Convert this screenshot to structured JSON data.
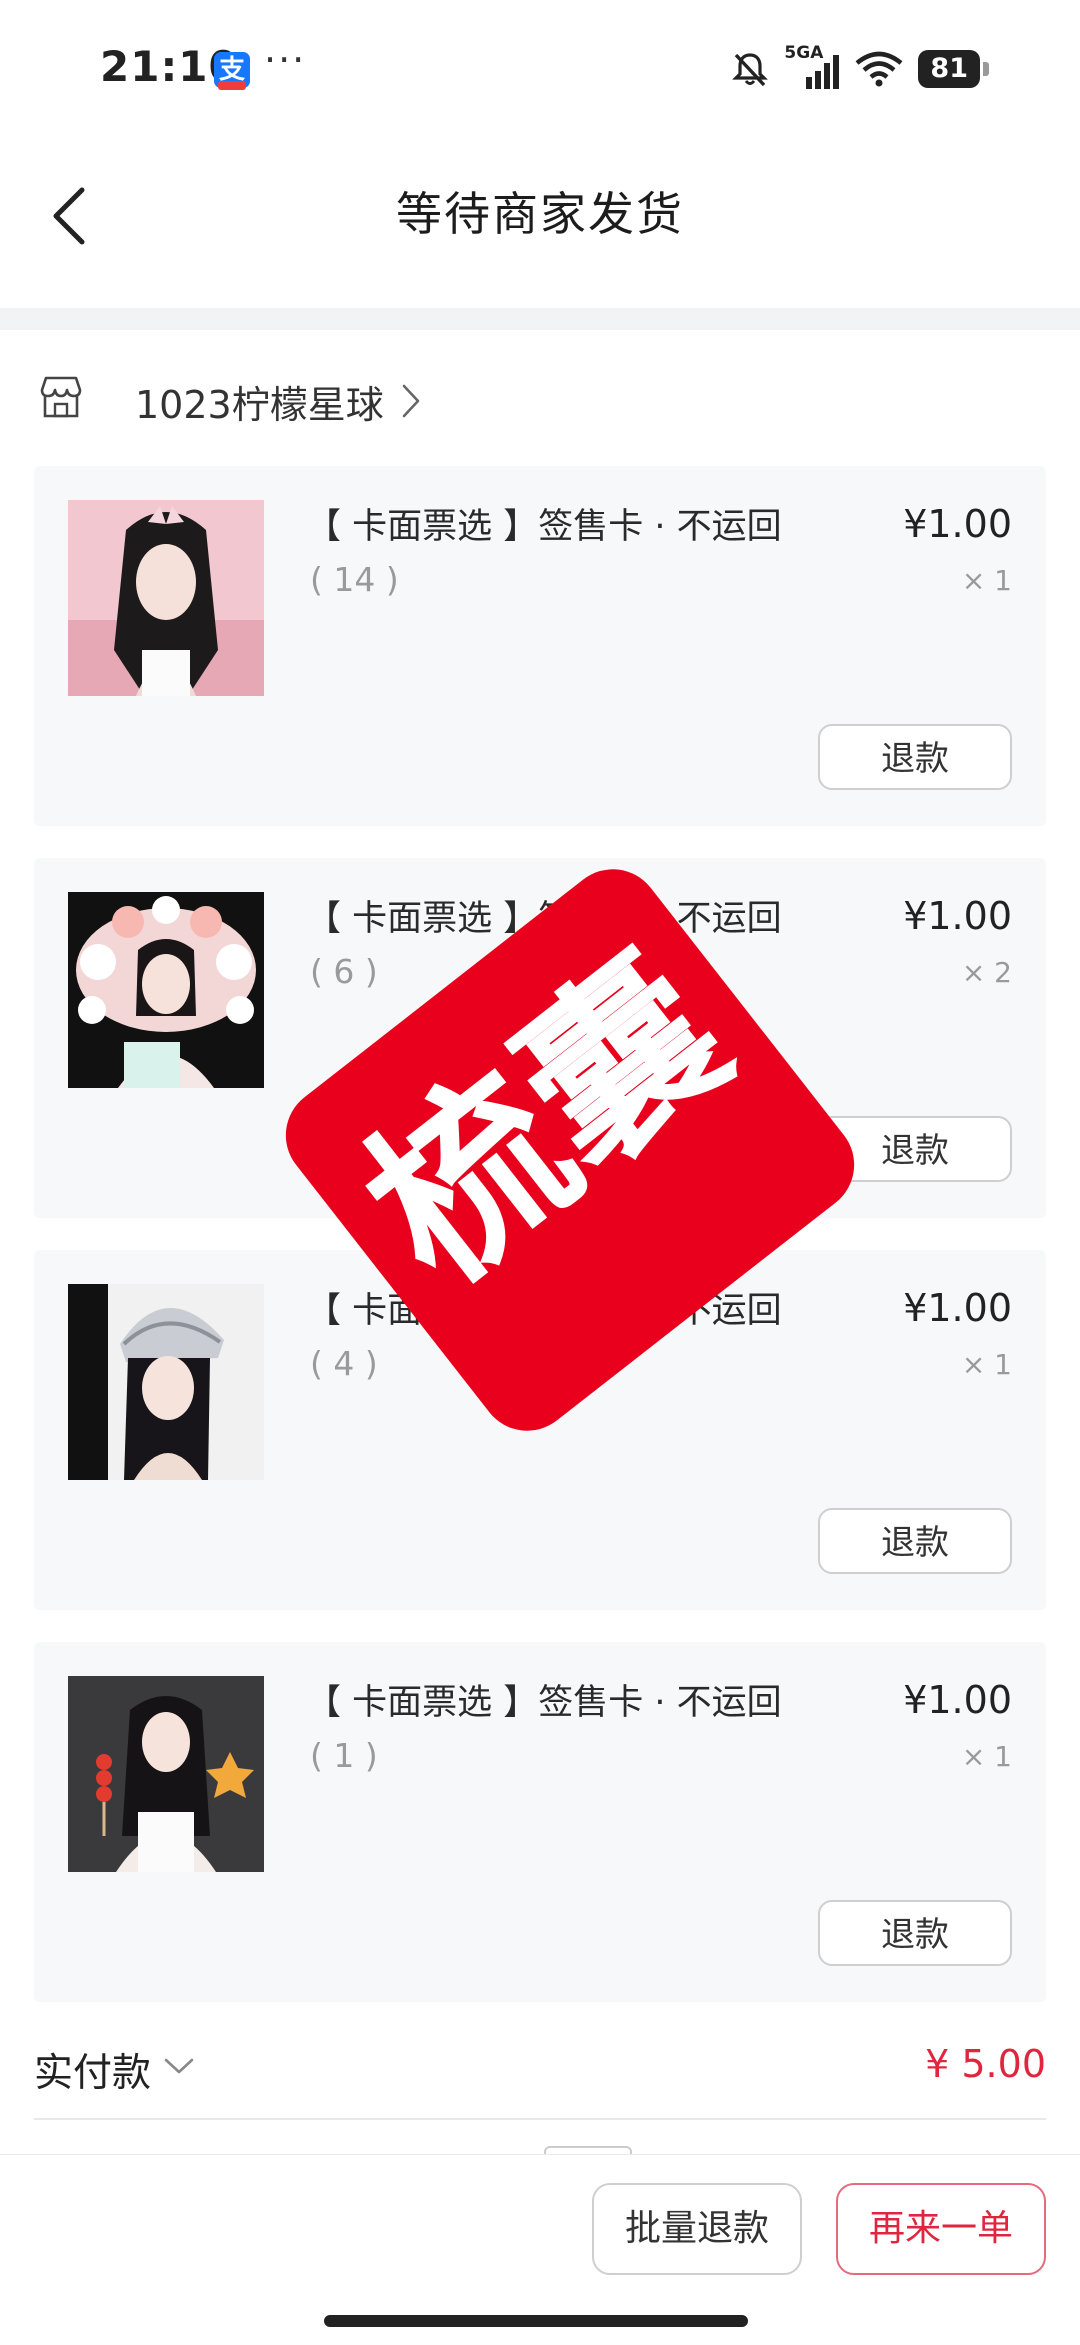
{
  "status_bar": {
    "time": "21:10",
    "app_badge": "支",
    "more": "···",
    "network": "5GA",
    "battery": "81"
  },
  "nav": {
    "title": "等待商家发货"
  },
  "shop": {
    "name": "1023柠檬星球"
  },
  "items": [
    {
      "title": "【 卡面票选 】签售卡 · 不运回",
      "sub": "( 14 )",
      "price": "¥1.00",
      "qty": "× 1",
      "refund": "退款"
    },
    {
      "title": "【 卡面票选 】签售卡 · 不运回",
      "sub": "( 6 )",
      "price": "¥1.00",
      "qty": "× 2",
      "refund": "退款"
    },
    {
      "title": "【 卡面票选 】签售卡 · 不运回",
      "sub": "( 4 )",
      "price": "¥1.00",
      "qty": "× 1",
      "refund": "退款"
    },
    {
      "title": "【 卡面票选 】签售卡 · 不运回",
      "sub": "( 1 )",
      "price": "¥1.00",
      "qty": "× 1",
      "refund": "退款"
    }
  ],
  "payment": {
    "label": "实付款",
    "amount": "¥ 5.00"
  },
  "stamp": {
    "text": "梳囊"
  },
  "bottom": {
    "batch_refund": "批量退款",
    "reorder": "再来一单"
  },
  "colors": {
    "accent_red": "#e0263f",
    "stamp_red": "#e8001c",
    "card_bg": "#f7f8fa"
  }
}
